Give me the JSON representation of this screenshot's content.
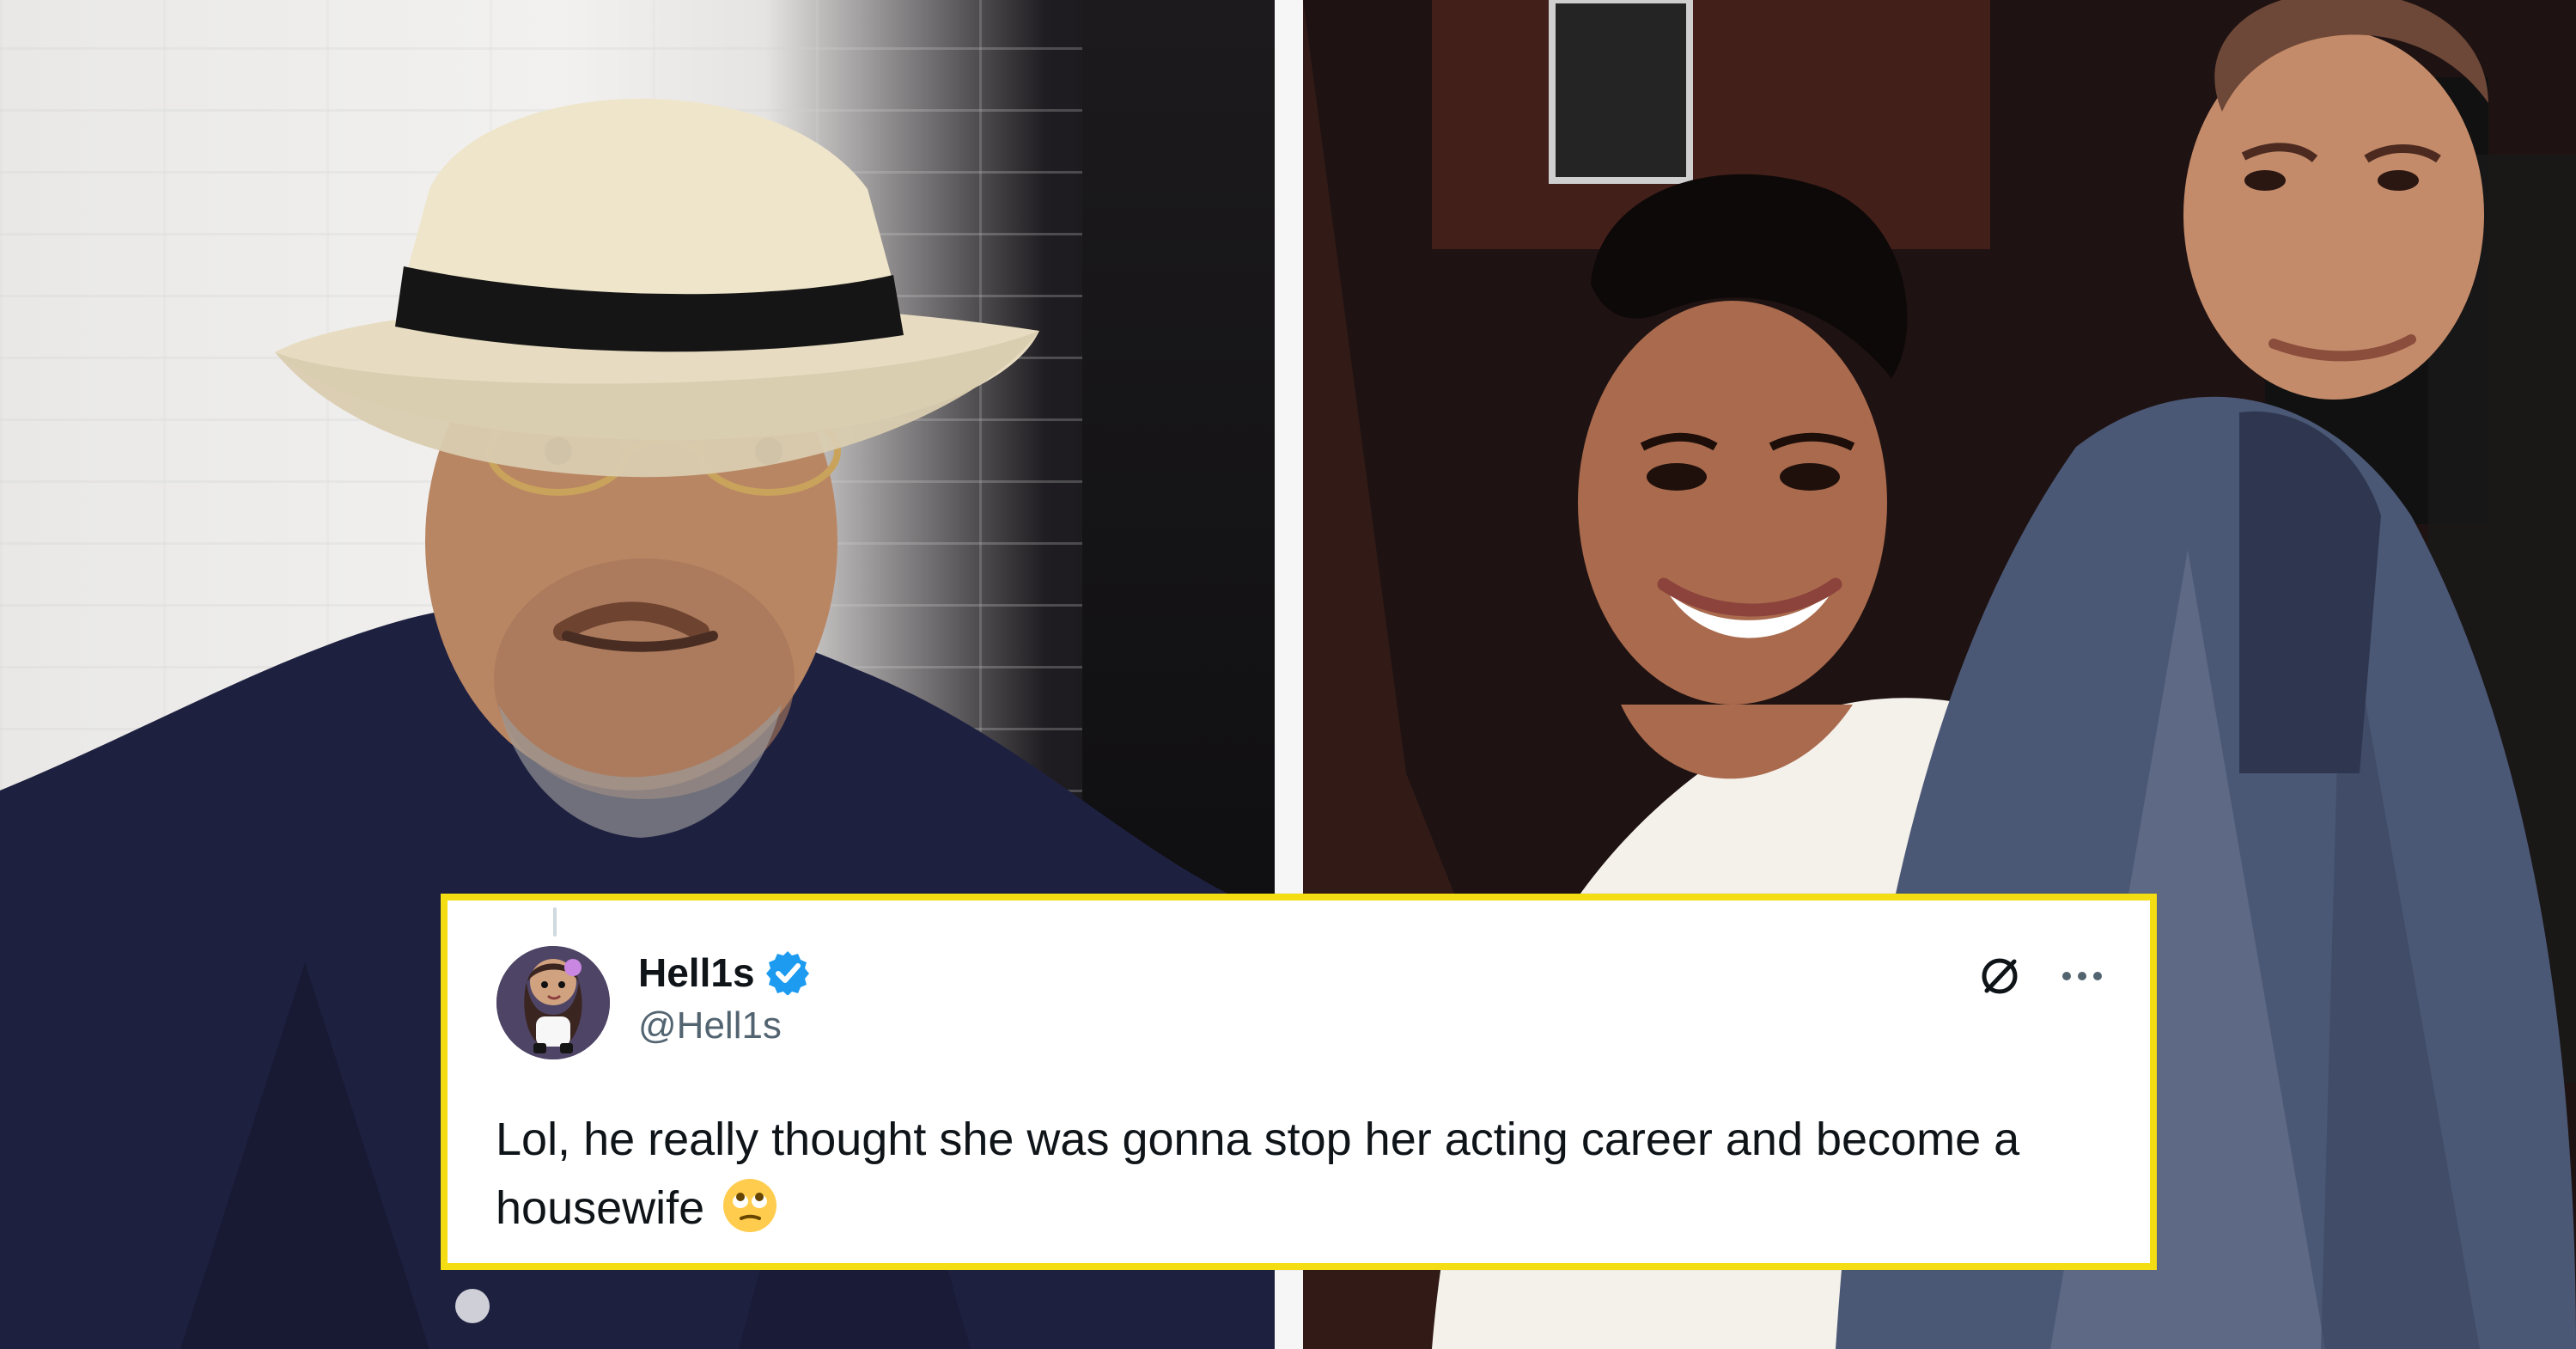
{
  "post": {
    "display_name": "Hell1s",
    "handle": "@Hell1s",
    "text": "Lol, he really thought she was gonna stop her acting career and become a housewife",
    "emoji": "🙄",
    "verified_icon": "verified-badge-icon",
    "action_icons": [
      "grok-icon",
      "more-options-icon"
    ],
    "highlight_color": "#f4dd12"
  }
}
